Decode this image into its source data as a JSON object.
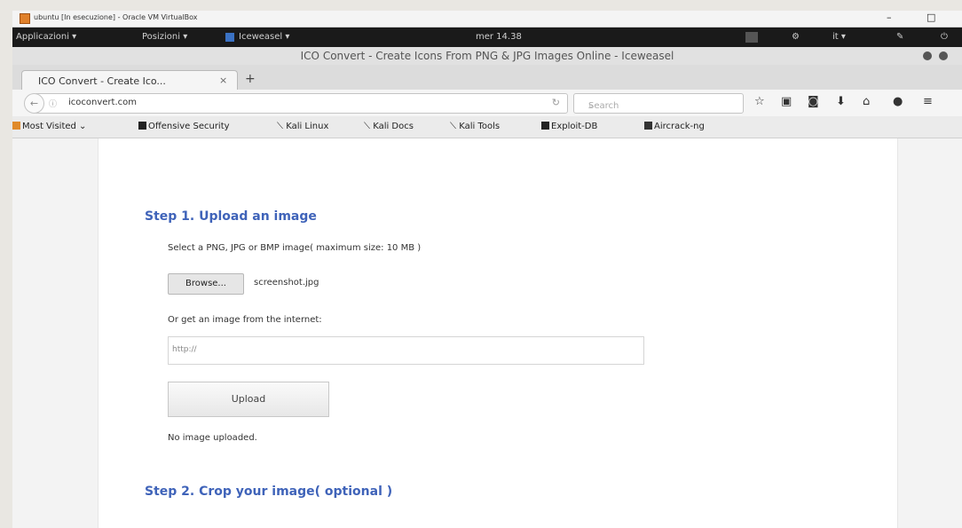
{
  "vm_window": {
    "title": "ubuntu [In esecuzione] - Oracle VM VirtualBox",
    "minimize": "–",
    "maximize": "□"
  },
  "gnome_bar": {
    "applications": "Applicazioni ▾",
    "places": "Posizioni ▾",
    "app": "Iceweasel ▾",
    "clock": "mer 14.38",
    "lang": "it ▾"
  },
  "browser": {
    "window_title": "ICO Convert - Create Icons From PNG & JPG Images Online - Iceweasel",
    "tab_title": "ICO Convert - Create Ico...",
    "tab_close": "×",
    "new_tab": "+",
    "url": "icoconvert.com",
    "search_placeholder": "Search",
    "bookmarks": [
      {
        "label": "Most Visited",
        "icon": "folder-icon"
      },
      {
        "label": "Offensive Security",
        "icon": "offsec-icon"
      },
      {
        "label": "Kali Linux",
        "icon": "kali-icon"
      },
      {
        "label": "Kali Docs",
        "icon": "kali-icon"
      },
      {
        "label": "Kali Tools",
        "icon": "kali-icon"
      },
      {
        "label": "Exploit-DB",
        "icon": "exploitdb-icon"
      },
      {
        "label": "Aircrack-ng",
        "icon": "aircrack-icon"
      }
    ]
  },
  "page": {
    "step1_title": "Step 1. Upload an image",
    "select_text": "Select a PNG, JPG or BMP image( maximum size: 10 MB )",
    "browse_label": "Browse...",
    "file_name": "screenshot.jpg",
    "internet_text": "Or get an image from the internet:",
    "url_value": "http://",
    "upload_label": "Upload",
    "status_text": "No image uploaded.",
    "step2_title": "Step 2. Crop your image( optional )"
  },
  "colors": {
    "heading": "#3f63b9",
    "gnome_bar": "#1a1a1a"
  }
}
